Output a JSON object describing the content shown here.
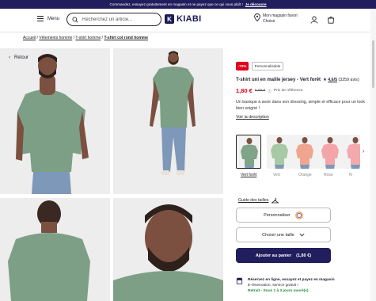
{
  "banner": {
    "text": "Commandez, essayez gratuitement en magasin et ne payez que ce qui vous plaît !",
    "link": "Je découvre"
  },
  "header": {
    "menu_label": "Menu",
    "search_placeholder": "Recherchez un article...",
    "logo_text": "KIABI",
    "store_line1": "Mon magasin favori",
    "store_line2": "Choisir"
  },
  "breadcrumb": {
    "items": [
      "Accueil",
      "Vêtements homme",
      "T-shirt homme"
    ],
    "current": "T-shirt col rond homme"
  },
  "gallery": {
    "back_label": "Retour"
  },
  "product": {
    "discount_badge": "-70%",
    "custom_badge": "Personnalisable",
    "title": "T-shirt uni en maille jersey - Vert forêt",
    "rating_value": "4,6/5",
    "rating_count": "(3259 avis)",
    "price_now": "1,80 €",
    "price_old": "6,00 €",
    "price_ref": "Prix de référence",
    "description": "Un basique à avoir dans son dressing, simple et efficace pour un look bien soigné !",
    "more_link": "Voir la description",
    "colors": [
      {
        "label": "Vert forêt",
        "shirt": "#7fa488"
      },
      {
        "label": "Vert",
        "shirt": "#a7c9a6"
      },
      {
        "label": "Orange",
        "shirt": "#f0a590"
      },
      {
        "label": "Rose",
        "shirt": "#f3a5a8"
      },
      {
        "label": "N",
        "shirt": "#f4a9ae"
      }
    ],
    "size_guide": "Guide des tailles",
    "personalize_btn": "Personnaliser",
    "size_select": "Choisir une taille",
    "add_to_cart_btn": "Ajouter au panier",
    "add_to_cart_price": "(1,80 €)"
  },
  "reservation": {
    "line1": "Réservez en ligne, essayez et payez en magasin",
    "line2": "E-réservation, service gratuit !",
    "line3": "Retrait - Sous 1 à 3 jours ouvré(s)"
  },
  "colors": {
    "brand": "#221d5c",
    "price": "#e2001a",
    "shirt": "#7d9f86"
  }
}
